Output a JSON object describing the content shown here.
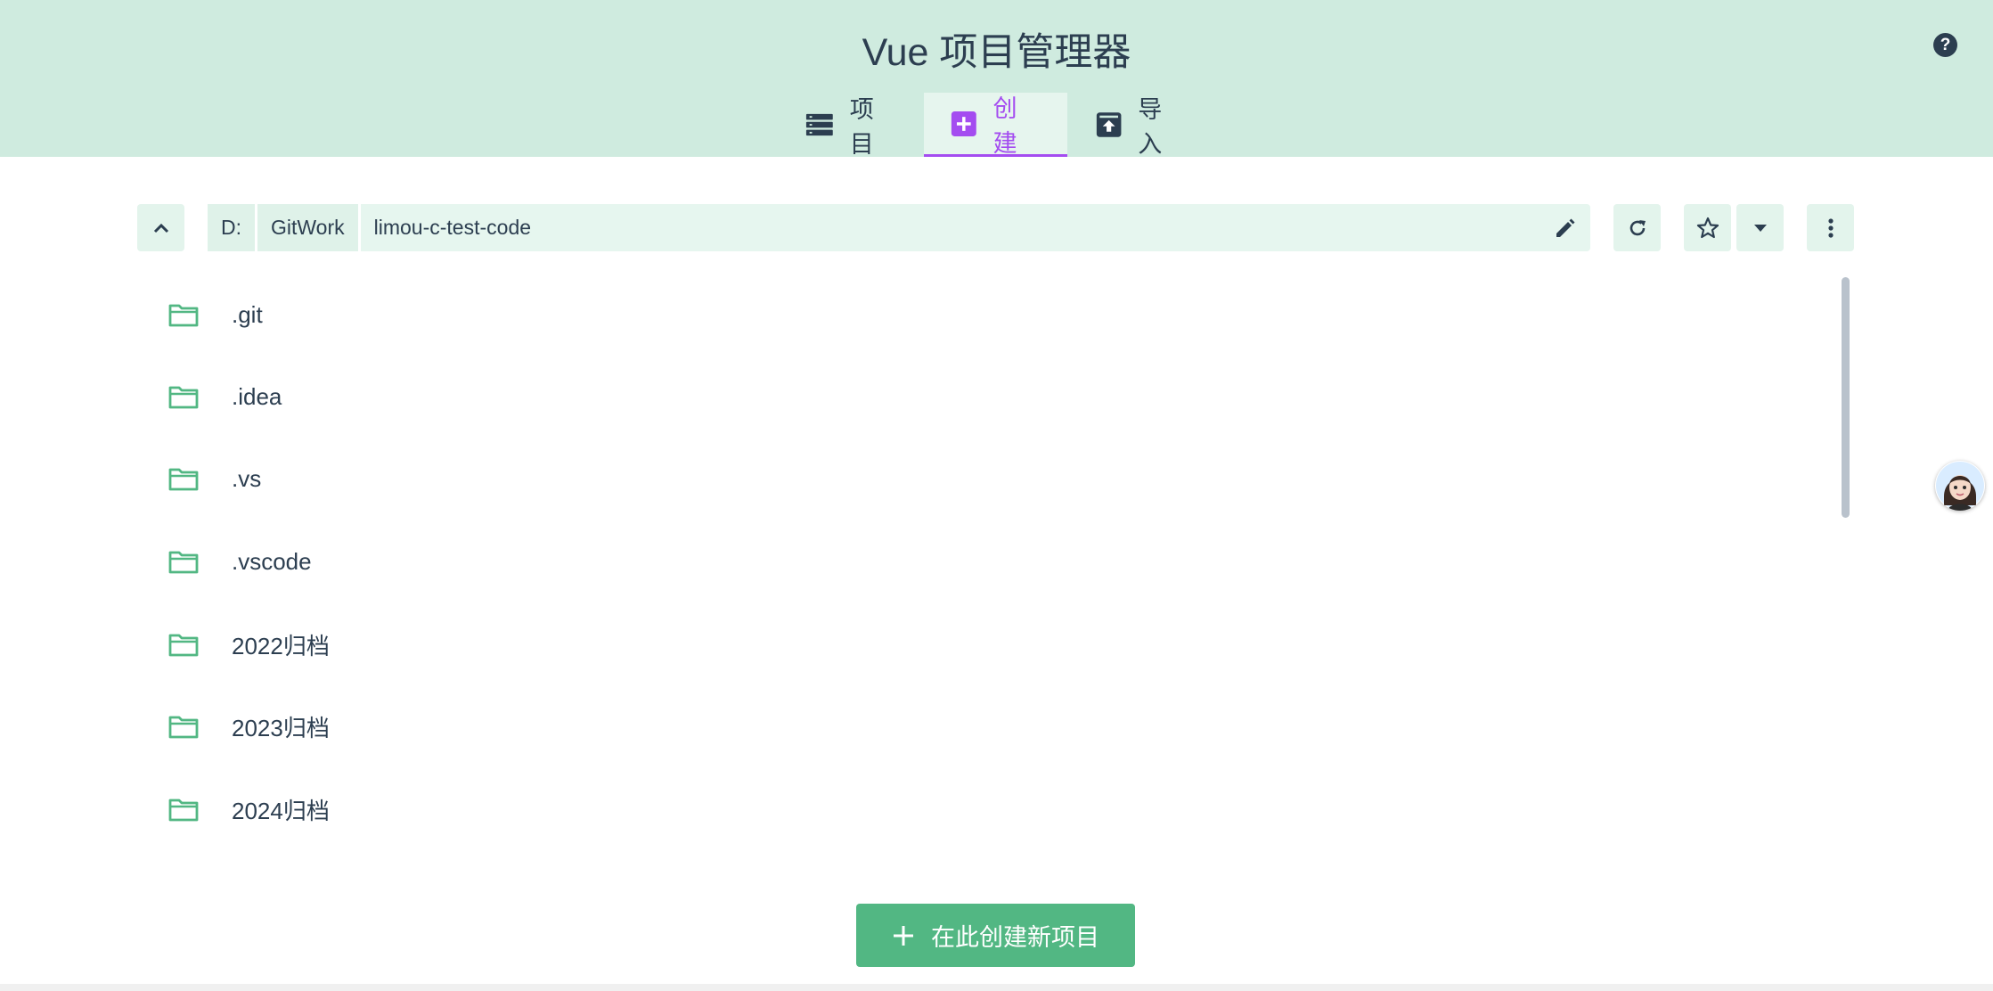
{
  "app": {
    "title": "Vue 项目管理器",
    "help": "?"
  },
  "tabs": [
    {
      "label": "项目",
      "icon": "list-icon",
      "active": false
    },
    {
      "label": "创建",
      "icon": "plus-box-icon",
      "active": true
    },
    {
      "label": "导入",
      "icon": "import-icon",
      "active": false
    }
  ],
  "path": {
    "crumbs": [
      "D:",
      "GitWork",
      "limou-c-test-code"
    ]
  },
  "folders": [
    ".git",
    ".idea",
    ".vs",
    ".vscode",
    "2022归档",
    "2023归档",
    "2024归档"
  ],
  "actions": {
    "create_label": "在此创建新项目"
  },
  "colors": {
    "header_bg": "#cfebdf",
    "accent": "#a44cf0",
    "primary": "#52b783",
    "text": "#2c3e50"
  }
}
